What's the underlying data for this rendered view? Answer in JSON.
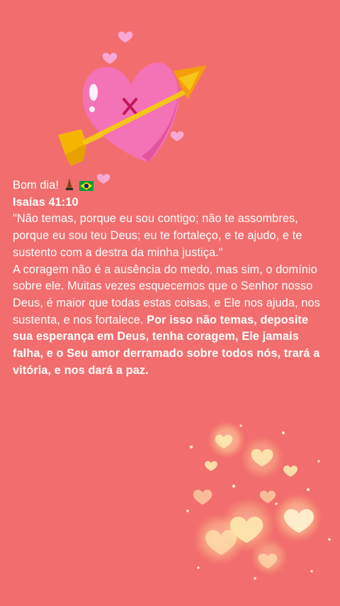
{
  "message": {
    "greeting": "Bom dia!",
    "greeting_emojis": [
      "praying-hands-icon",
      "brazil-flag-icon"
    ],
    "verse_ref": "Isaías 41:10",
    "verse_text": "\"Não temas, porque eu sou contigo; não te assombres, porque eu sou teu Deus; eu te fortaleço, e te ajudo, e te sustento com a destra da minha justiça.\"",
    "reflection": "A coragem não é a ausência do medo, mas sim, o domínio sobre ele. Muitas vezes esquecemos que o Senhor nosso Deus, é maior que todas estas coisas, e Ele nos ajuda, nos sustenta, e nos fortalece. ",
    "reflection_bold": "Por isso não temas, deposite sua esperança em Deus, tenha coragem, Ele jamais falha, e o Seu amor derramado sobre todos nós, trará a vitória, e nos dará a paz."
  },
  "colors": {
    "background": "#F26E6E",
    "text": "#FFFFFF",
    "heart": "#F472B6",
    "arrow": "#F5C518",
    "glow_hearts": "#FFE9B0"
  },
  "icons": {
    "sticker": "heart-with-arrow-icon",
    "decoration": "glowing-hearts-icon"
  }
}
